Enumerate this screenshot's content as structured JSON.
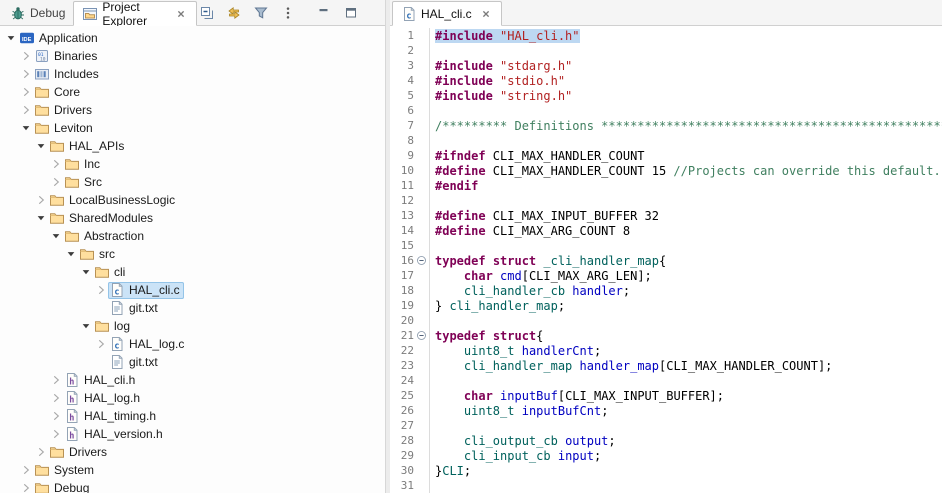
{
  "colors": {
    "syntax": {
      "keyword": "#7f0055",
      "string": "#b22222",
      "comment": "#3f7f5f",
      "type": "#00615c",
      "field": "#0000c0",
      "default": "#000000"
    },
    "selection_highlight": "#bdd8f2",
    "tree_selection": "#cbe3f7"
  },
  "left_panel": {
    "tabs": [
      {
        "label": "Debug",
        "icon": "bug-icon",
        "active": false,
        "closable": false
      },
      {
        "label": "Project Explorer",
        "icon": "project-explorer-icon",
        "active": true,
        "closable": true
      }
    ],
    "toolbar": [
      {
        "action": "collapse-all",
        "icon": "collapse-all-icon"
      },
      {
        "action": "link-with-editor",
        "icon": "link-editor-icon"
      },
      {
        "action": "filter",
        "icon": "filter-icon"
      },
      {
        "action": "view-menu",
        "icon": "view-menu-icon"
      }
    ],
    "window_buttons": [
      {
        "action": "minimize",
        "icon": "minimize-icon"
      },
      {
        "action": "maximize",
        "icon": "maximize-icon"
      }
    ],
    "tree": [
      {
        "label": "Application",
        "level": 0,
        "state": "expanded",
        "icon": "ide-project-icon"
      },
      {
        "label": "Binaries",
        "level": 1,
        "state": "collapsed",
        "icon": "binaries-icon"
      },
      {
        "label": "Includes",
        "level": 1,
        "state": "collapsed",
        "icon": "includes-icon"
      },
      {
        "label": "Core",
        "level": 1,
        "state": "collapsed",
        "icon": "folder-icon"
      },
      {
        "label": "Drivers",
        "level": 1,
        "state": "collapsed",
        "icon": "folder-icon"
      },
      {
        "label": "Leviton",
        "level": 1,
        "state": "expanded",
        "icon": "folder-icon"
      },
      {
        "label": "HAL_APIs",
        "level": 2,
        "state": "expanded",
        "icon": "folder-icon"
      },
      {
        "label": "Inc",
        "level": 3,
        "state": "collapsed",
        "icon": "folder-icon"
      },
      {
        "label": "Src",
        "level": 3,
        "state": "collapsed",
        "icon": "folder-icon"
      },
      {
        "label": "LocalBusinessLogic",
        "level": 2,
        "state": "collapsed",
        "icon": "folder-icon"
      },
      {
        "label": "SharedModules",
        "level": 2,
        "state": "expanded",
        "icon": "folder-icon"
      },
      {
        "label": "Abstraction",
        "level": 3,
        "state": "expanded",
        "icon": "folder-icon"
      },
      {
        "label": "src",
        "level": 4,
        "state": "expanded",
        "icon": "folder-icon"
      },
      {
        "label": "cli",
        "level": 5,
        "state": "expanded",
        "icon": "folder-icon"
      },
      {
        "label": "HAL_cli.c",
        "level": 6,
        "state": "collapsed",
        "icon": "c-file-icon",
        "selected": true
      },
      {
        "label": "git.txt",
        "level": 6,
        "state": "leaf",
        "icon": "text-file-icon"
      },
      {
        "label": "log",
        "level": 5,
        "state": "expanded",
        "icon": "folder-icon"
      },
      {
        "label": "HAL_log.c",
        "level": 6,
        "state": "collapsed",
        "icon": "c-file-icon"
      },
      {
        "label": "git.txt",
        "level": 6,
        "state": "leaf",
        "icon": "text-file-icon"
      },
      {
        "label": "HAL_cli.h",
        "level": 3,
        "state": "collapsed",
        "icon": "h-file-icon"
      },
      {
        "label": "HAL_log.h",
        "level": 3,
        "state": "collapsed",
        "icon": "h-file-icon"
      },
      {
        "label": "HAL_timing.h",
        "level": 3,
        "state": "collapsed",
        "icon": "h-file-icon"
      },
      {
        "label": "HAL_version.h",
        "level": 3,
        "state": "collapsed",
        "icon": "h-file-icon"
      },
      {
        "label": "Drivers",
        "level": 2,
        "state": "collapsed",
        "icon": "folder-icon"
      },
      {
        "label": "System",
        "level": 1,
        "state": "collapsed",
        "icon": "folder-icon"
      },
      {
        "label": "Debug",
        "level": 1,
        "state": "collapsed",
        "icon": "folder-icon"
      }
    ]
  },
  "editor": {
    "tabs": [
      {
        "label": "HAL_cli.c",
        "icon": "c-file-icon",
        "active": true,
        "closable": true
      }
    ],
    "lines": [
      {
        "n": 1,
        "hl": true,
        "seg": [
          [
            "#include",
            "kw"
          ],
          [
            " ",
            "pln"
          ],
          [
            "\"HAL_cli.h\"",
            "str"
          ]
        ]
      },
      {
        "n": 2,
        "seg": []
      },
      {
        "n": 3,
        "seg": [
          [
            "#include",
            "kw"
          ],
          [
            " ",
            "pln"
          ],
          [
            "\"stdarg.h\"",
            "str"
          ]
        ]
      },
      {
        "n": 4,
        "seg": [
          [
            "#include",
            "kw"
          ],
          [
            " ",
            "pln"
          ],
          [
            "\"stdio.h\"",
            "str"
          ]
        ]
      },
      {
        "n": 5,
        "seg": [
          [
            "#include",
            "kw"
          ],
          [
            " ",
            "pln"
          ],
          [
            "\"string.h\"",
            "str"
          ]
        ]
      },
      {
        "n": 6,
        "seg": []
      },
      {
        "n": 7,
        "seg": [
          [
            "/********* Definitions **********************************************************************",
            "cmt"
          ]
        ]
      },
      {
        "n": 8,
        "seg": []
      },
      {
        "n": 9,
        "seg": [
          [
            "#ifndef",
            "kw"
          ],
          [
            " CLI_MAX_HANDLER_COUNT",
            "pln"
          ]
        ]
      },
      {
        "n": 10,
        "seg": [
          [
            "#define",
            "kw"
          ],
          [
            " CLI_MAX_HANDLER_COUNT 15 ",
            "pln"
          ],
          [
            "//Projects can override this default.",
            "cmt"
          ]
        ]
      },
      {
        "n": 11,
        "seg": [
          [
            "#endif",
            "kw"
          ]
        ]
      },
      {
        "n": 12,
        "seg": []
      },
      {
        "n": 13,
        "seg": [
          [
            "#define",
            "kw"
          ],
          [
            " CLI_MAX_INPUT_BUFFER 32",
            "pln"
          ]
        ]
      },
      {
        "n": 14,
        "seg": [
          [
            "#define",
            "kw"
          ],
          [
            " CLI_MAX_ARG_COUNT 8",
            "pln"
          ]
        ]
      },
      {
        "n": 15,
        "seg": []
      },
      {
        "n": 16,
        "fold": true,
        "seg": [
          [
            "typedef",
            "kw"
          ],
          [
            " ",
            "pln"
          ],
          [
            "struct",
            "kw"
          ],
          [
            " ",
            "pln"
          ],
          [
            "_cli_handler_map",
            "typ"
          ],
          [
            "{",
            "pln"
          ]
        ]
      },
      {
        "n": 17,
        "seg": [
          [
            "    ",
            "pln"
          ],
          [
            "char",
            "kw"
          ],
          [
            " ",
            "pln"
          ],
          [
            "cmd",
            "fld"
          ],
          [
            "[CLI_MAX_ARG_LEN];",
            "pln"
          ]
        ]
      },
      {
        "n": 18,
        "seg": [
          [
            "    ",
            "pln"
          ],
          [
            "cli_handler_cb",
            "typ"
          ],
          [
            " ",
            "pln"
          ],
          [
            "handler",
            "fld"
          ],
          [
            ";",
            "pln"
          ]
        ]
      },
      {
        "n": 19,
        "seg": [
          [
            "} ",
            "pln"
          ],
          [
            "cli_handler_map",
            "typ"
          ],
          [
            ";",
            "pln"
          ]
        ]
      },
      {
        "n": 20,
        "seg": []
      },
      {
        "n": 21,
        "fold": true,
        "seg": [
          [
            "typedef",
            "kw"
          ],
          [
            " ",
            "pln"
          ],
          [
            "struct",
            "kw"
          ],
          [
            "{",
            "pln"
          ]
        ]
      },
      {
        "n": 22,
        "seg": [
          [
            "    ",
            "pln"
          ],
          [
            "uint8_t",
            "typ"
          ],
          [
            " ",
            "pln"
          ],
          [
            "handlerCnt",
            "fld"
          ],
          [
            ";",
            "pln"
          ]
        ]
      },
      {
        "n": 23,
        "seg": [
          [
            "    ",
            "pln"
          ],
          [
            "cli_handler_map",
            "typ"
          ],
          [
            " ",
            "pln"
          ],
          [
            "handler_map",
            "fld"
          ],
          [
            "[CLI_MAX_HANDLER_COUNT];",
            "pln"
          ]
        ]
      },
      {
        "n": 24,
        "seg": []
      },
      {
        "n": 25,
        "seg": [
          [
            "    ",
            "pln"
          ],
          [
            "char",
            "kw"
          ],
          [
            " ",
            "pln"
          ],
          [
            "inputBuf",
            "fld"
          ],
          [
            "[CLI_MAX_INPUT_BUFFER];",
            "pln"
          ]
        ]
      },
      {
        "n": 26,
        "seg": [
          [
            "    ",
            "pln"
          ],
          [
            "uint8_t",
            "typ"
          ],
          [
            " ",
            "pln"
          ],
          [
            "inputBufCnt",
            "fld"
          ],
          [
            ";",
            "pln"
          ]
        ]
      },
      {
        "n": 27,
        "seg": []
      },
      {
        "n": 28,
        "seg": [
          [
            "    ",
            "pln"
          ],
          [
            "cli_output_cb",
            "typ"
          ],
          [
            " ",
            "pln"
          ],
          [
            "output",
            "fld"
          ],
          [
            ";",
            "pln"
          ]
        ]
      },
      {
        "n": 29,
        "seg": [
          [
            "    ",
            "pln"
          ],
          [
            "cli_input_cb",
            "typ"
          ],
          [
            " ",
            "pln"
          ],
          [
            "input",
            "fld"
          ],
          [
            ";",
            "pln"
          ]
        ]
      },
      {
        "n": 30,
        "seg": [
          [
            "}",
            "pln"
          ],
          [
            "CLI",
            "typ"
          ],
          [
            ";",
            "pln"
          ]
        ]
      },
      {
        "n": 31,
        "seg": []
      }
    ]
  }
}
